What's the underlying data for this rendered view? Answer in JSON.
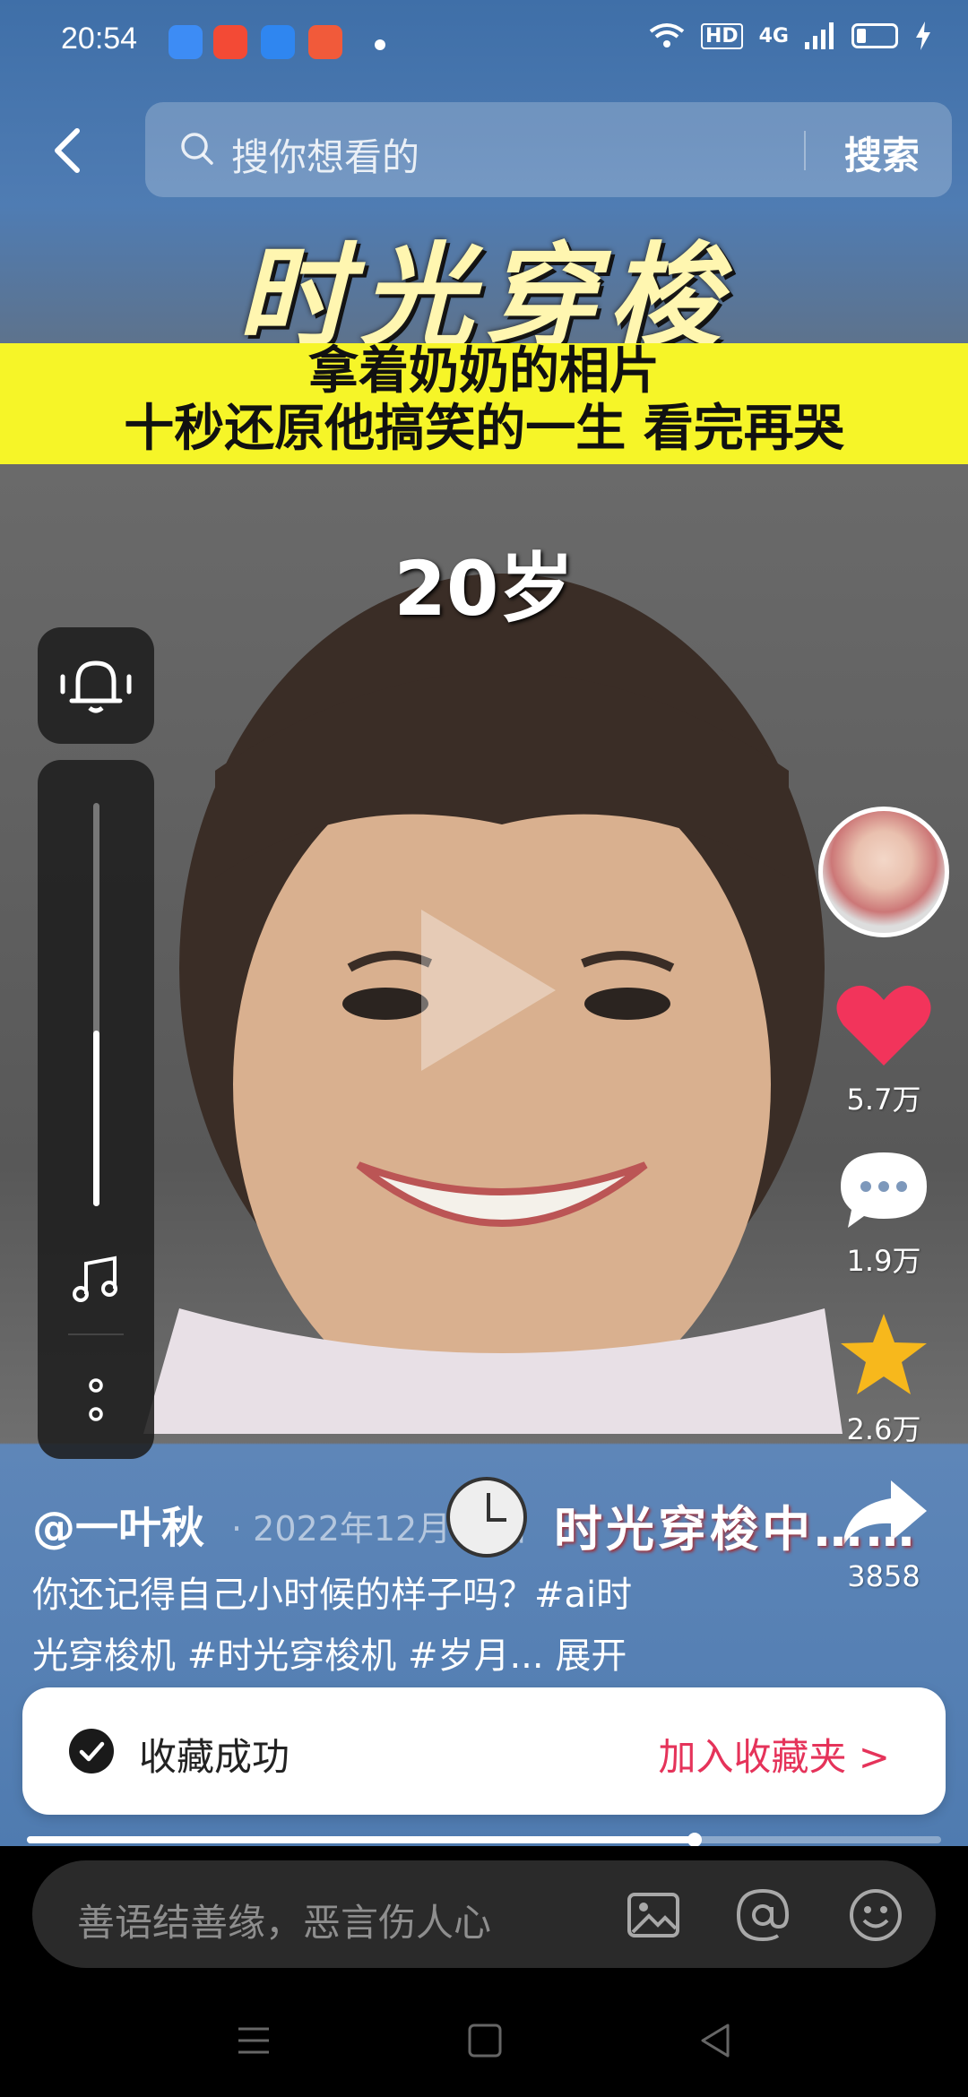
{
  "status_bar": {
    "time": "20:54",
    "network_label": "4G",
    "hd_label": "HD",
    "app_icons": [
      "browser-icon",
      "video-app-icon",
      "files-icon",
      "photos-app-icon"
    ]
  },
  "search": {
    "placeholder": "搜你想看的",
    "button_label": "搜索"
  },
  "video": {
    "title_big": "时光穿梭",
    "banner_line1": "拿着奶奶的相片",
    "banner_line2": "十秒还原他搞笑的一生 看完再哭",
    "age_caption": "20岁",
    "overlay_caption": "时光穿梭中……",
    "progress": 0.73
  },
  "actions": {
    "likes": "5.7万",
    "comments": "1.9万",
    "favorites": "2.6万",
    "shares": "3858"
  },
  "post": {
    "author": "@一叶秋",
    "date": "· 2022年12月05日",
    "desc_line1": "你还记得自己小时候的样子吗？#ai时",
    "desc_line2": "光穿梭机 #时光穿梭机 #岁月...",
    "expand_label": "展开"
  },
  "toast": {
    "message": "收藏成功",
    "link_label": "加入收藏夹 >"
  },
  "comment": {
    "placeholder": "善语结善缘，恶言伤人心"
  },
  "colors": {
    "like": "#f2345b",
    "favorite": "#f7b81c",
    "accent_link": "#e5335a",
    "banner": "#f6f528"
  }
}
